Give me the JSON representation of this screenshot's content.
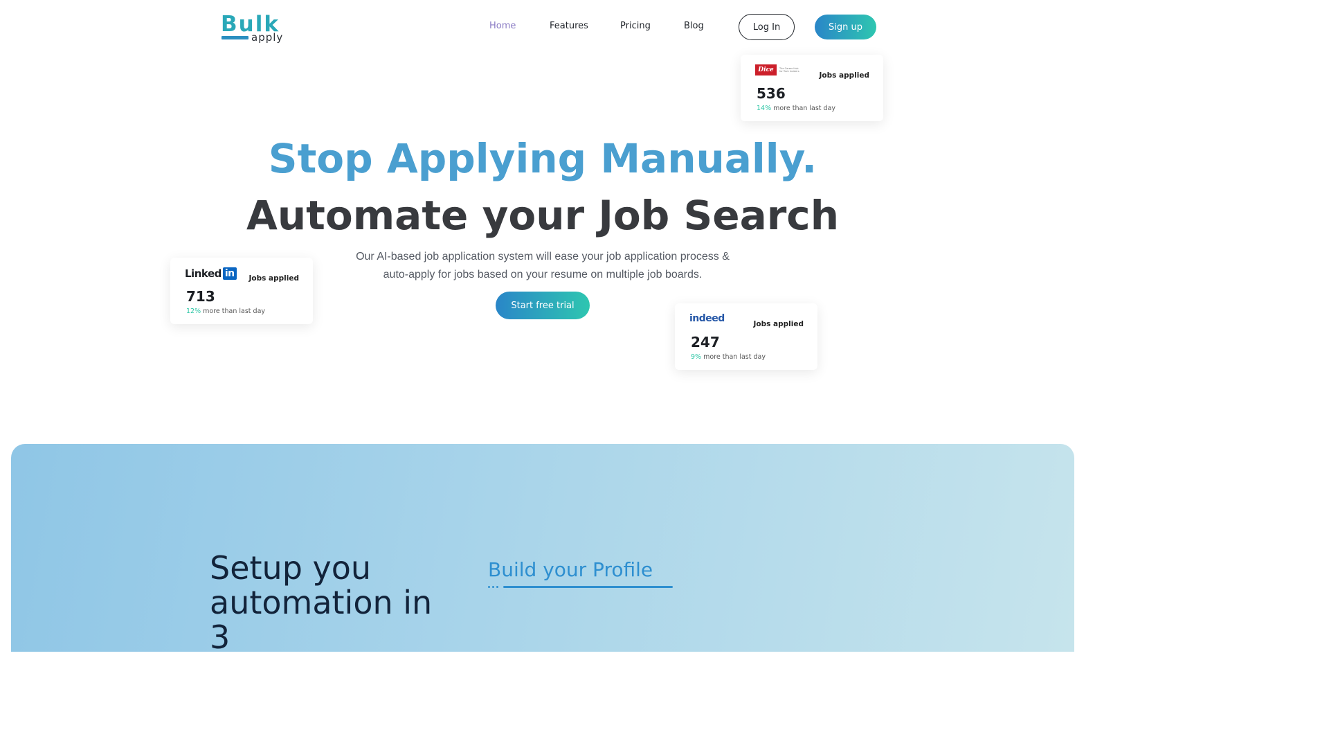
{
  "header": {
    "logo_main": "Bulk",
    "logo_sub": "apply",
    "nav": [
      {
        "label": "Home",
        "active": true
      },
      {
        "label": "Features",
        "active": false
      },
      {
        "label": "Pricing",
        "active": false
      },
      {
        "label": "Blog",
        "active": false
      }
    ],
    "login_label": "Log In",
    "signup_label": "Sign up"
  },
  "hero": {
    "headline": "Stop Applying Manually.",
    "subheadline": "Automate your Job Search",
    "description_line1": "Our AI-based job application system will ease your job application process &",
    "description_line2": "auto-apply for jobs based on your resume on multiple job boards.",
    "cta_label": "Start free trial"
  },
  "stat_cards": [
    {
      "board": "Dice",
      "logo_text": "Dice",
      "tagline": "The Career Hub for Tech Insiders",
      "label": "Jobs applied",
      "value": "536",
      "percent": "14%",
      "trend_text": " more than last day"
    },
    {
      "board": "LinkedIn",
      "logo_text": "Linked",
      "logo_badge": "in",
      "label": "Jobs applied",
      "value": "713",
      "percent": "12%",
      "trend_text": " more than last day"
    },
    {
      "board": "Indeed",
      "logo_text": "indeed",
      "label": "Jobs applied",
      "value": "247",
      "percent": "9%",
      "trend_text": " more than last day"
    }
  ],
  "steps": {
    "title": "Setup you automation in 3",
    "active_tab": "Build your Profile"
  },
  "colors": {
    "brand_blue": "#4a9fd0",
    "gradient_start": "#2a86c8",
    "gradient_end": "#2ec6b0",
    "trend_green": "#2ec6a6",
    "dice_red": "#cc1f2a",
    "linkedin_blue": "#0a66c2",
    "indeed_blue": "#2557a7"
  }
}
